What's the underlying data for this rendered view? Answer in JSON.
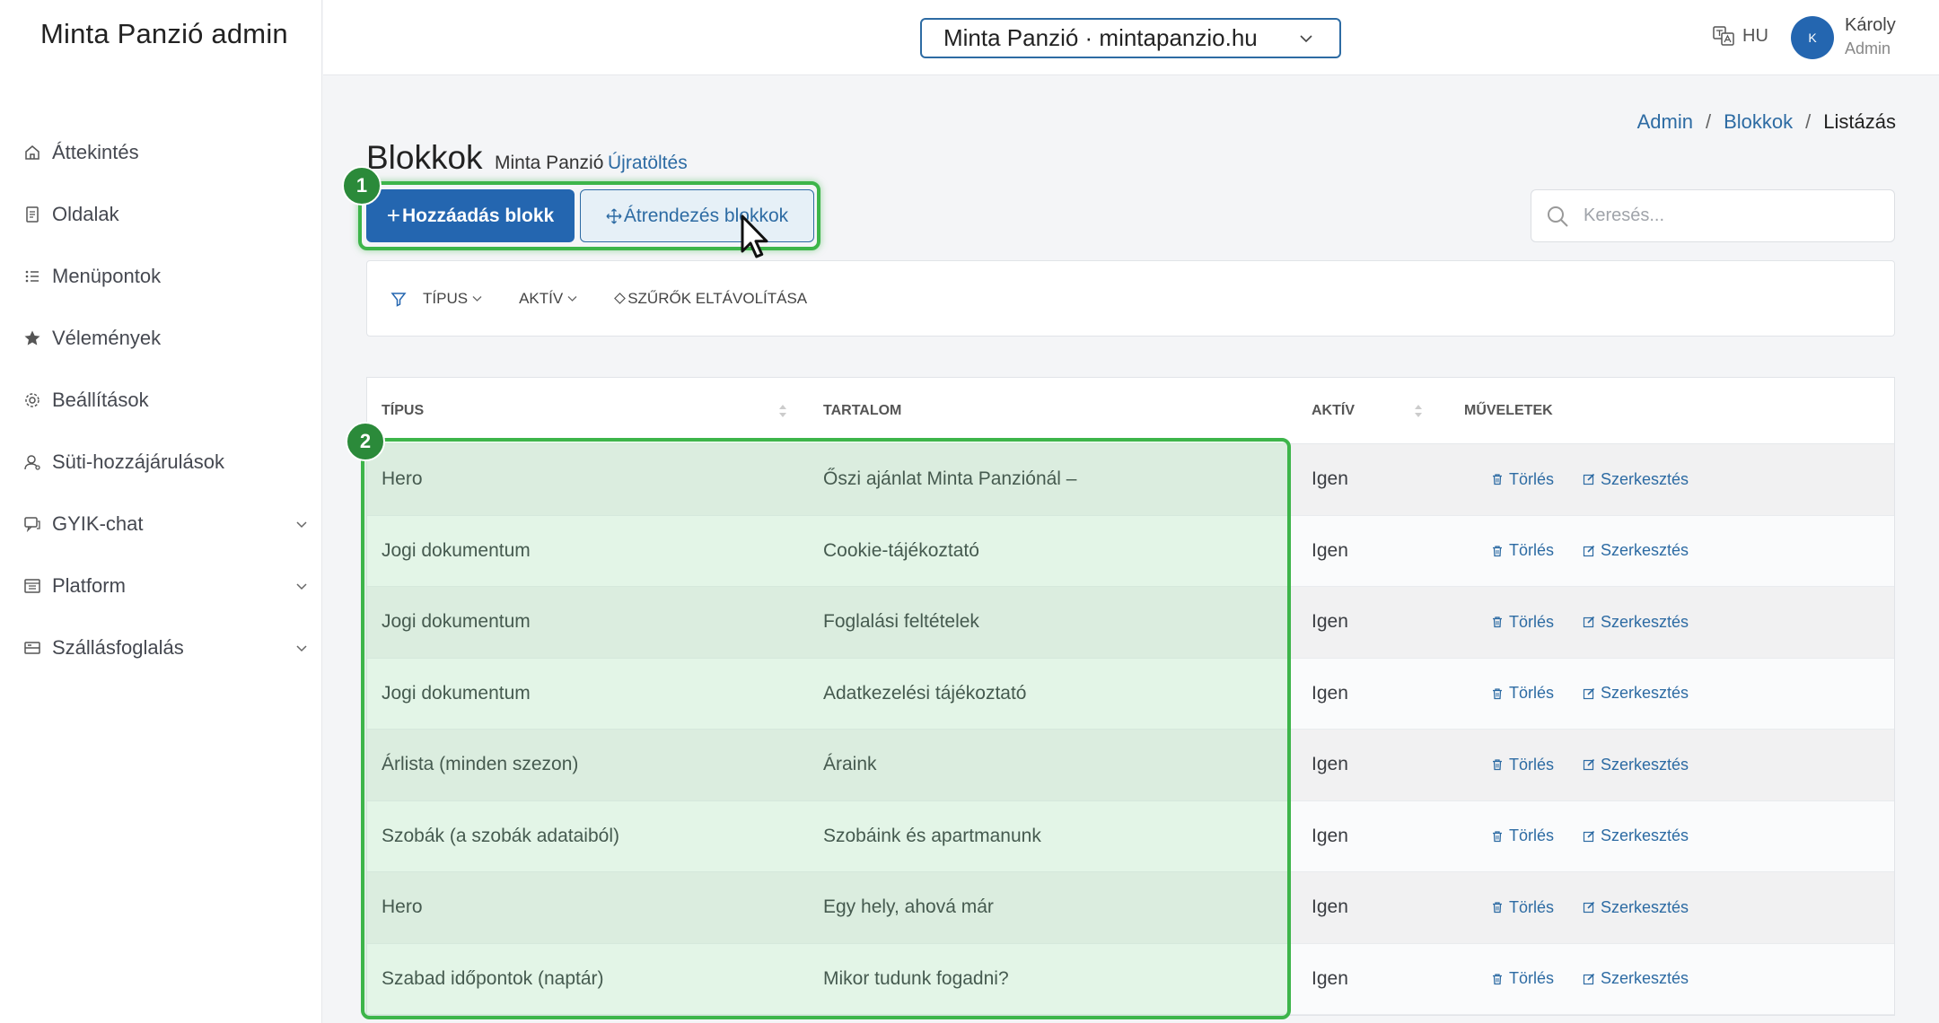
{
  "app": {
    "title": "Minta Panzió admin"
  },
  "sidebar": {
    "items": [
      {
        "label": "Áttekintés",
        "icon": "home-icon"
      },
      {
        "label": "Oldalak",
        "icon": "page-icon"
      },
      {
        "label": "Menüpontok",
        "icon": "list-icon"
      },
      {
        "label": "Vélemények",
        "icon": "star-icon"
      },
      {
        "label": "Beállítások",
        "icon": "gear-icon"
      },
      {
        "label": "Süti-hozzájárulások",
        "icon": "user-icon"
      },
      {
        "label": "GYIK-chat",
        "icon": "chat-icon"
      },
      {
        "label": "Platform",
        "icon": "platform-icon"
      },
      {
        "label": "Szállásfoglalás",
        "icon": "bed-icon"
      }
    ]
  },
  "topbar": {
    "site_select": "Minta Panzió · mintapanzio.hu",
    "lang": "HU",
    "avatar_initial": "K",
    "user_name": "Károly",
    "user_role": "Admin"
  },
  "breadcrumb": {
    "item1": "Admin",
    "item2": "Blokkok",
    "current": "Listázás",
    "sep": "/"
  },
  "page": {
    "title": "Blokkok",
    "subtitle": "Minta Panzió",
    "reload": "Újratöltés",
    "add_button": "Hozzáadás blokk",
    "reorder_button": "Átrendezés blokkok",
    "search_placeholder": "Keresés..."
  },
  "filters": {
    "type": "TÍPUS",
    "active": "AKTÍV",
    "clear": "SZŰRŐK ELTÁVOLÍTÁSA"
  },
  "table": {
    "headers": {
      "type": "TÍPUS",
      "content": "TARTALOM",
      "active": "AKTÍV",
      "actions": "MŰVELETEK"
    },
    "delete_label": "Törlés",
    "edit_label": "Szerkesztés",
    "rows": [
      {
        "type": "Hero",
        "content": "Őszi ajánlat Minta Panziónál –",
        "active": "Igen"
      },
      {
        "type": "Jogi dokumentum",
        "content": "Cookie-tájékoztató",
        "active": "Igen"
      },
      {
        "type": "Jogi dokumentum",
        "content": "Foglalási feltételek",
        "active": "Igen"
      },
      {
        "type": "Jogi dokumentum",
        "content": "Adatkezelési tájékoztató",
        "active": "Igen"
      },
      {
        "type": "Árlista (minden szezon)",
        "content": "Áraink",
        "active": "Igen"
      },
      {
        "type": "Szobák (a szobák adataiból)",
        "content": "Szobáink és apartmanunk",
        "active": "Igen"
      },
      {
        "type": "Hero",
        "content": "Egy hely, ahová már",
        "active": "Igen"
      },
      {
        "type": "Szabad időpontok (naptár)",
        "content": "Mikor tudunk fogadni?",
        "active": "Igen"
      }
    ]
  },
  "annotations": {
    "badge1": "1",
    "badge2": "2"
  },
  "colors": {
    "primary": "#2466b0",
    "highlight": "#3db54a",
    "link": "#2d6ba3"
  }
}
